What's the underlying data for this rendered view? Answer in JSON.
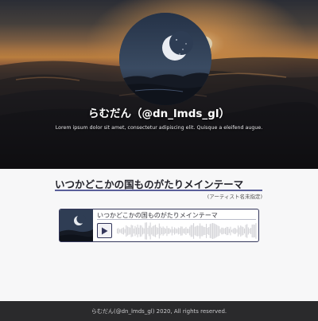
{
  "hero": {
    "name": "らむだん（@dn_lmds_gl）",
    "description": "Lorem ipsum dolor sit amet, consectetur adipiscing elit. Quisque a eleifend augue."
  },
  "main": {
    "song_title": "いつかどこかの国ものがたりメインテーマ",
    "artist_note": "(アーティスト名未指定)"
  },
  "player": {
    "track_title": "いつかどこかの国ものがたりメインテーマ",
    "play_icon": "play-icon"
  },
  "footer": {
    "copyright": "らむだん(@dn_lmds_gl) 2020, All rights reserved."
  },
  "colors": {
    "accent": "#34375c",
    "rule": "#5a5f9a",
    "footer_bg": "#2a2a2c"
  }
}
